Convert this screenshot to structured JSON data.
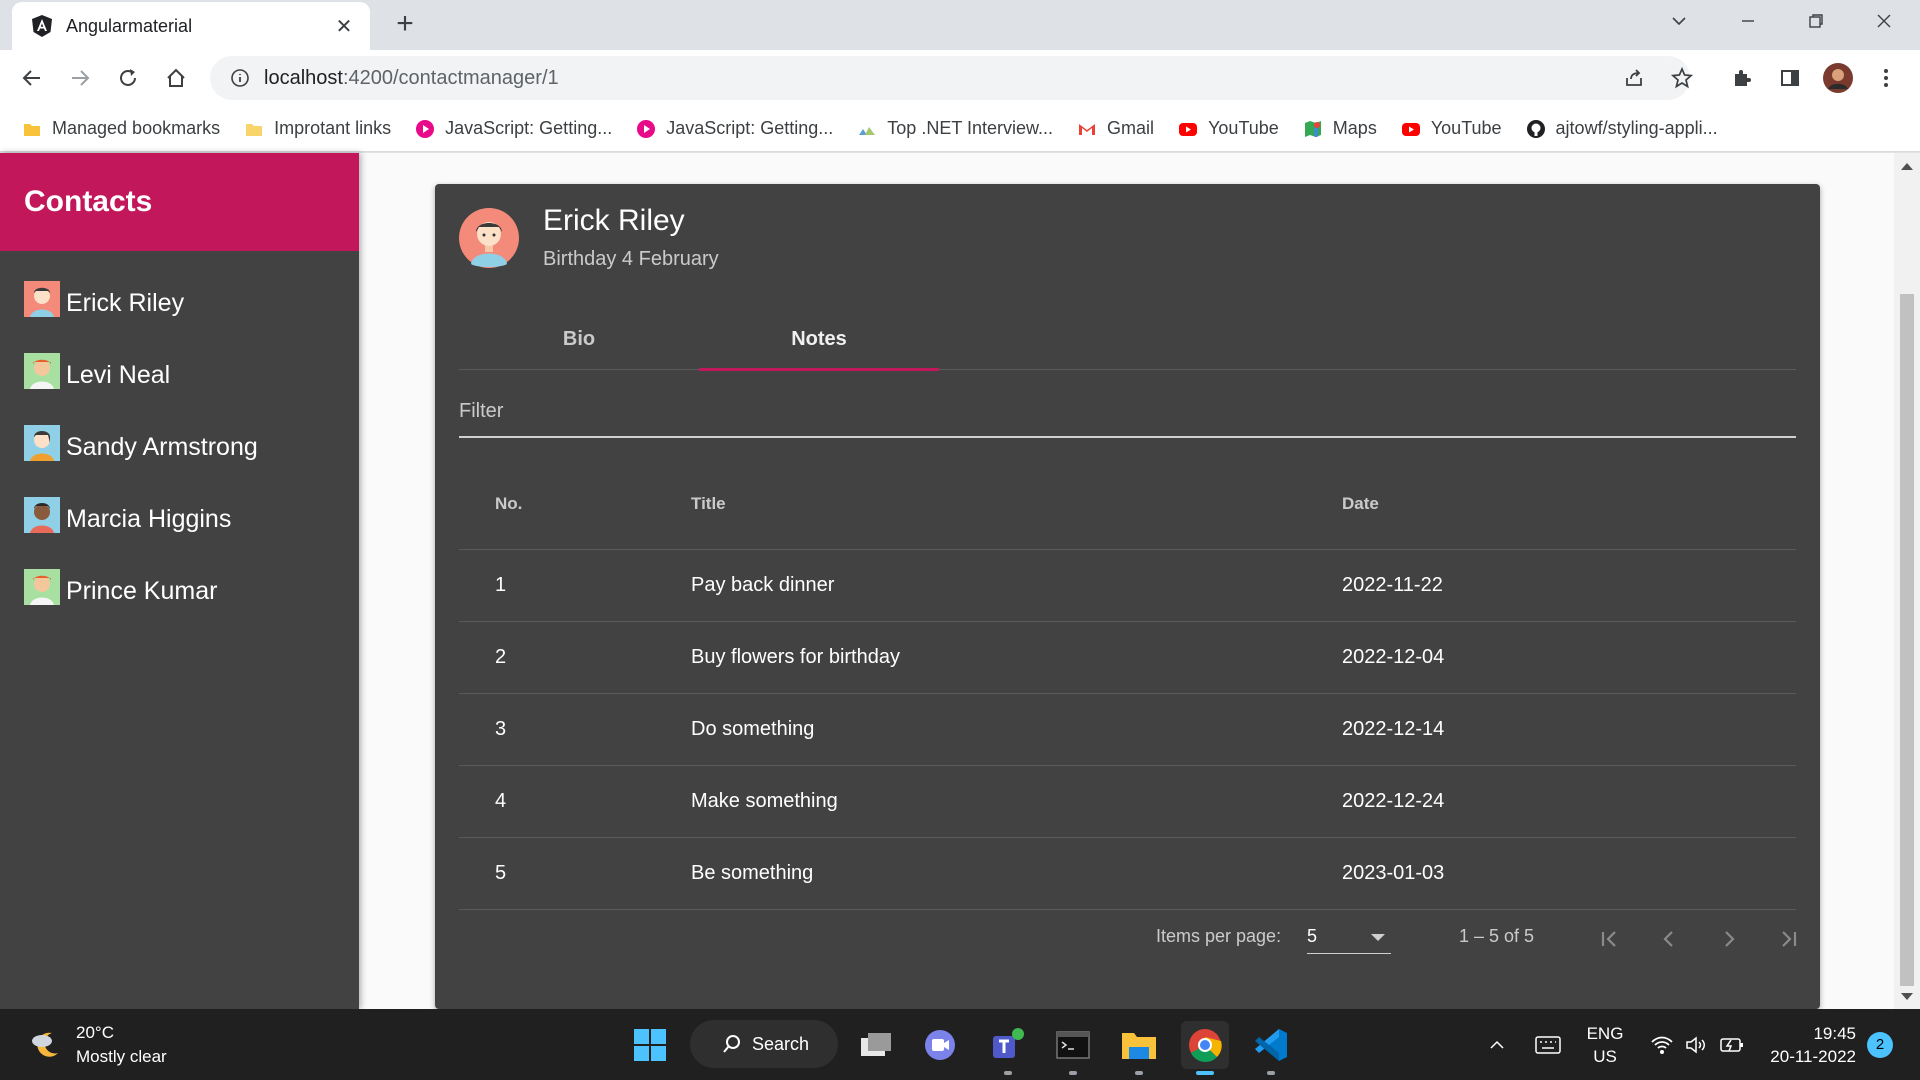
{
  "browser": {
    "tab_title": "Angularmaterial",
    "url_host": "localhost",
    "url_path": ":4200/contactmanager/1",
    "bookmarks": [
      {
        "label": "Managed bookmarks",
        "icon": "folder-icon"
      },
      {
        "label": "Improtant links",
        "icon": "folder-icon"
      },
      {
        "label": "JavaScript: Getting...",
        "icon": "pluralsight-icon"
      },
      {
        "label": "JavaScript: Getting...",
        "icon": "pluralsight-icon"
      },
      {
        "label": "Top .NET Interview...",
        "icon": "site-icon"
      },
      {
        "label": "Gmail",
        "icon": "gmail-icon"
      },
      {
        "label": "YouTube",
        "icon": "youtube-icon"
      },
      {
        "label": "Maps",
        "icon": "maps-icon"
      },
      {
        "label": "YouTube",
        "icon": "youtube-icon"
      },
      {
        "label": "ajtowf/styling-appli...",
        "icon": "github-icon"
      }
    ]
  },
  "sidebar": {
    "title": "Contacts",
    "contacts": [
      "Erick Riley",
      "Levi Neal",
      "Sandy Armstrong",
      "Marcia Higgins",
      "Prince Kumar"
    ]
  },
  "card": {
    "name": "Erick Riley",
    "subtitle": "Birthday 4 February",
    "tabs": [
      "Bio",
      "Notes"
    ],
    "active_tab": "Notes",
    "filter_placeholder": "Filter",
    "table": {
      "headers": [
        "No.",
        "Title",
        "Date"
      ],
      "rows": [
        [
          "1",
          "Pay back dinner",
          "2022-11-22"
        ],
        [
          "2",
          "Buy flowers for birthday",
          "2022-12-04"
        ],
        [
          "3",
          "Do something",
          "2022-12-14"
        ],
        [
          "4",
          "Make something",
          "2022-12-24"
        ],
        [
          "5",
          "Be something",
          "2023-01-03"
        ]
      ]
    },
    "paginator": {
      "label": "Items per page:",
      "page_size": "5",
      "range": "1 – 5 of 5"
    }
  },
  "taskbar": {
    "temperature": "20°C",
    "weather": "Mostly clear",
    "search_label": "Search",
    "lang_top": "ENG",
    "lang_bottom": "US",
    "time": "19:45",
    "date": "20-11-2022",
    "notification_count": "2"
  },
  "colors": {
    "primary": "#c2185b",
    "card_bg": "#424242",
    "sidebar_bg": "#424242"
  }
}
